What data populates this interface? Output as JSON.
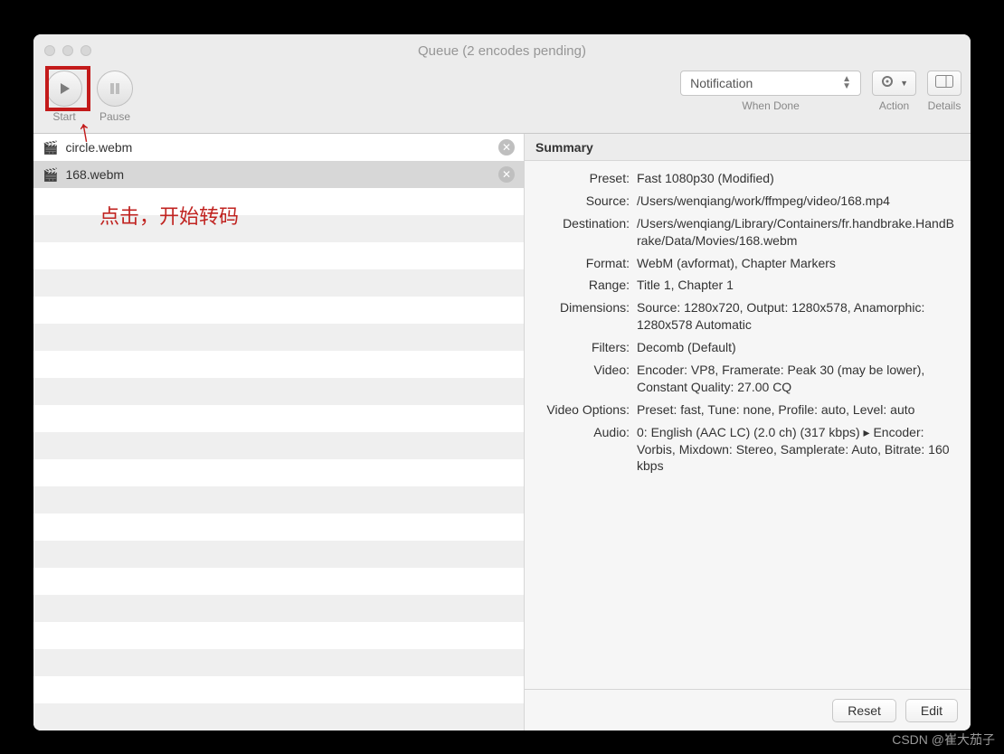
{
  "window": {
    "title": "Queue (2 encodes pending)"
  },
  "toolbar": {
    "start_label": "Start",
    "pause_label": "Pause",
    "when_done_selected": "Notification",
    "when_done_label": "When Done",
    "action_label": "Action",
    "details_label": "Details"
  },
  "annotation": {
    "text": "点击，开始转码"
  },
  "queue": {
    "items": [
      {
        "name": "circle.webm"
      },
      {
        "name": "168.webm"
      }
    ]
  },
  "summary": {
    "heading": "Summary",
    "fields": {
      "preset": {
        "label": "Preset:",
        "value": "Fast 1080p30 (Modified)"
      },
      "source": {
        "label": "Source:",
        "value": "/Users/wenqiang/work/ffmpeg/video/168.mp4"
      },
      "destination": {
        "label": "Destination:",
        "value": "/Users/wenqiang/Library/Containers/fr.handbrake.HandBrake/Data/Movies/168.webm"
      },
      "format": {
        "label": "Format:",
        "value": "WebM (avformat), Chapter Markers"
      },
      "range": {
        "label": "Range:",
        "value": "Title 1, Chapter 1"
      },
      "dimensions": {
        "label": "Dimensions:",
        "value": "Source: 1280x720, Output: 1280x578, Anamorphic: 1280x578 Automatic"
      },
      "filters": {
        "label": "Filters:",
        "value": "Decomb (Default)"
      },
      "video": {
        "label": "Video:",
        "value": "Encoder: VP8, Framerate: Peak 30 (may be lower), Constant Quality: 27.00 CQ"
      },
      "video_options": {
        "label": "Video Options:",
        "value": "Preset: fast, Tune: none, Profile: auto, Level: auto"
      },
      "audio": {
        "label": "Audio:",
        "value": "0: English (AAC LC) (2.0 ch) (317 kbps) ▸ Encoder: Vorbis, Mixdown: Stereo, Samplerate: Auto, Bitrate: 160 kbps"
      }
    },
    "reset_label": "Reset",
    "edit_label": "Edit"
  },
  "watermark": "CSDN @崔大茄子"
}
